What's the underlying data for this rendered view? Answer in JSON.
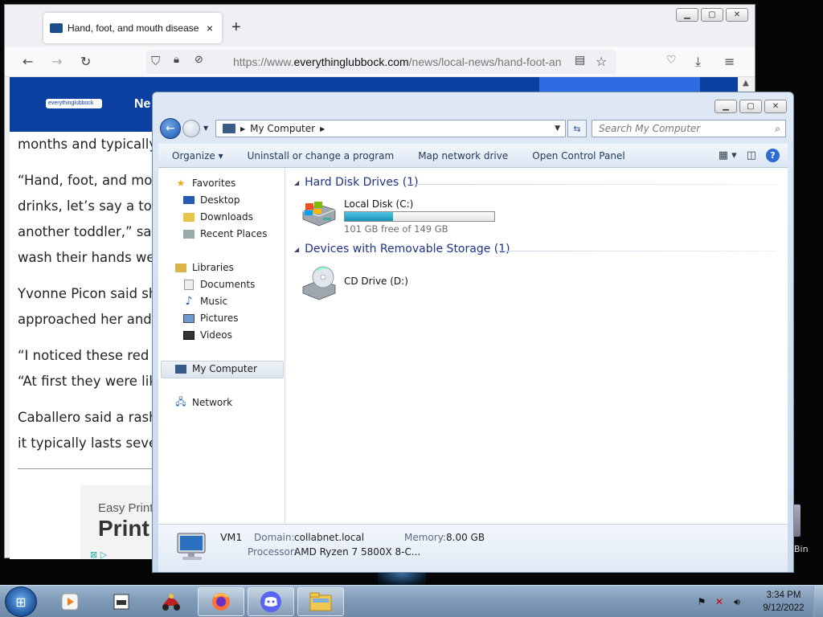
{
  "firefox": {
    "tab_title": "Hand, foot, and mouth disease",
    "url_prefix": "https://www.",
    "url_domain": "everythinglubbock.com",
    "url_path": "/news/local-news/hand-foot-an",
    "new_tab": "+",
    "tab_close": "×",
    "site_logo": "everythinglubbock",
    "site_nav_partial": "Ne",
    "article_lines": [
      "months and typically a",
      "“Hand, foot, and mout",
      "drinks, let’s say a todd",
      "another toddler,” said",
      "wash their hands well,",
      "Yvonne Picon said she",
      "approached her and sa",
      "“I noticed these red bu",
      "“At first they were like",
      "Caballero said a rash is",
      "it typically lasts seven"
    ],
    "ad_line1": "Easy Print",
    "ad_line2": "Print"
  },
  "explorer": {
    "address": "My Computer",
    "search_placeholder": "Search My Computer",
    "commands": {
      "organize": "Organize ▾",
      "uninstall": "Uninstall or change a program",
      "map_drive": "Map network drive",
      "control_panel": "Open Control Panel"
    },
    "nav": {
      "favorites": "Favorites",
      "desktop": "Desktop",
      "downloads": "Downloads",
      "recent": "Recent Places",
      "libraries": "Libraries",
      "documents": "Documents",
      "music": "Music",
      "pictures": "Pictures",
      "videos": "Videos",
      "my_computer": "My Computer",
      "network": "Network"
    },
    "groups": {
      "hdd": "Hard Disk Drives (1)",
      "removable": "Devices with Removable Storage (1)"
    },
    "drives": {
      "c_name": "Local Disk (C:)",
      "c_free": "101 GB free of 149 GB",
      "c_used_fraction": 0.32,
      "d_name": "CD Drive (D:)"
    },
    "details": {
      "name": "VM1",
      "domain_label": "Domain:",
      "domain_value": "collabnet.local",
      "memory_label": "Memory:",
      "memory_value": "8.00 GB",
      "processor_label": "Processor:",
      "processor_value": "AMD Ryzen 7 5800X 8-C..."
    }
  },
  "desktop": {
    "recycle_bin_partial": "Bin"
  },
  "taskbar": {
    "time": "3:34 PM",
    "date": "9/12/2022"
  },
  "colors": {
    "site_banner": "#0b3fa0",
    "explorer_group": "#1e3287",
    "disk_fill": "#1c8fb8"
  }
}
